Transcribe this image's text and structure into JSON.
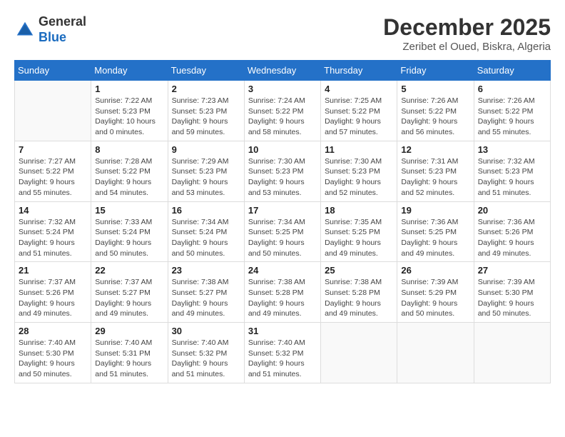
{
  "header": {
    "logo_general": "General",
    "logo_blue": "Blue",
    "month_title": "December 2025",
    "subtitle": "Zeribet el Oued, Biskra, Algeria"
  },
  "days_of_week": [
    "Sunday",
    "Monday",
    "Tuesday",
    "Wednesday",
    "Thursday",
    "Friday",
    "Saturday"
  ],
  "weeks": [
    [
      {
        "day": "",
        "info": ""
      },
      {
        "day": "1",
        "info": "Sunrise: 7:22 AM\nSunset: 5:23 PM\nDaylight: 10 hours\nand 0 minutes."
      },
      {
        "day": "2",
        "info": "Sunrise: 7:23 AM\nSunset: 5:23 PM\nDaylight: 9 hours\nand 59 minutes."
      },
      {
        "day": "3",
        "info": "Sunrise: 7:24 AM\nSunset: 5:22 PM\nDaylight: 9 hours\nand 58 minutes."
      },
      {
        "day": "4",
        "info": "Sunrise: 7:25 AM\nSunset: 5:22 PM\nDaylight: 9 hours\nand 57 minutes."
      },
      {
        "day": "5",
        "info": "Sunrise: 7:26 AM\nSunset: 5:22 PM\nDaylight: 9 hours\nand 56 minutes."
      },
      {
        "day": "6",
        "info": "Sunrise: 7:26 AM\nSunset: 5:22 PM\nDaylight: 9 hours\nand 55 minutes."
      }
    ],
    [
      {
        "day": "7",
        "info": "Sunrise: 7:27 AM\nSunset: 5:22 PM\nDaylight: 9 hours\nand 55 minutes."
      },
      {
        "day": "8",
        "info": "Sunrise: 7:28 AM\nSunset: 5:22 PM\nDaylight: 9 hours\nand 54 minutes."
      },
      {
        "day": "9",
        "info": "Sunrise: 7:29 AM\nSunset: 5:23 PM\nDaylight: 9 hours\nand 53 minutes."
      },
      {
        "day": "10",
        "info": "Sunrise: 7:30 AM\nSunset: 5:23 PM\nDaylight: 9 hours\nand 53 minutes."
      },
      {
        "day": "11",
        "info": "Sunrise: 7:30 AM\nSunset: 5:23 PM\nDaylight: 9 hours\nand 52 minutes."
      },
      {
        "day": "12",
        "info": "Sunrise: 7:31 AM\nSunset: 5:23 PM\nDaylight: 9 hours\nand 52 minutes."
      },
      {
        "day": "13",
        "info": "Sunrise: 7:32 AM\nSunset: 5:23 PM\nDaylight: 9 hours\nand 51 minutes."
      }
    ],
    [
      {
        "day": "14",
        "info": "Sunrise: 7:32 AM\nSunset: 5:24 PM\nDaylight: 9 hours\nand 51 minutes."
      },
      {
        "day": "15",
        "info": "Sunrise: 7:33 AM\nSunset: 5:24 PM\nDaylight: 9 hours\nand 50 minutes."
      },
      {
        "day": "16",
        "info": "Sunrise: 7:34 AM\nSunset: 5:24 PM\nDaylight: 9 hours\nand 50 minutes."
      },
      {
        "day": "17",
        "info": "Sunrise: 7:34 AM\nSunset: 5:25 PM\nDaylight: 9 hours\nand 50 minutes."
      },
      {
        "day": "18",
        "info": "Sunrise: 7:35 AM\nSunset: 5:25 PM\nDaylight: 9 hours\nand 49 minutes."
      },
      {
        "day": "19",
        "info": "Sunrise: 7:36 AM\nSunset: 5:25 PM\nDaylight: 9 hours\nand 49 minutes."
      },
      {
        "day": "20",
        "info": "Sunrise: 7:36 AM\nSunset: 5:26 PM\nDaylight: 9 hours\nand 49 minutes."
      }
    ],
    [
      {
        "day": "21",
        "info": "Sunrise: 7:37 AM\nSunset: 5:26 PM\nDaylight: 9 hours\nand 49 minutes."
      },
      {
        "day": "22",
        "info": "Sunrise: 7:37 AM\nSunset: 5:27 PM\nDaylight: 9 hours\nand 49 minutes."
      },
      {
        "day": "23",
        "info": "Sunrise: 7:38 AM\nSunset: 5:27 PM\nDaylight: 9 hours\nand 49 minutes."
      },
      {
        "day": "24",
        "info": "Sunrise: 7:38 AM\nSunset: 5:28 PM\nDaylight: 9 hours\nand 49 minutes."
      },
      {
        "day": "25",
        "info": "Sunrise: 7:38 AM\nSunset: 5:28 PM\nDaylight: 9 hours\nand 49 minutes."
      },
      {
        "day": "26",
        "info": "Sunrise: 7:39 AM\nSunset: 5:29 PM\nDaylight: 9 hours\nand 50 minutes."
      },
      {
        "day": "27",
        "info": "Sunrise: 7:39 AM\nSunset: 5:30 PM\nDaylight: 9 hours\nand 50 minutes."
      }
    ],
    [
      {
        "day": "28",
        "info": "Sunrise: 7:40 AM\nSunset: 5:30 PM\nDaylight: 9 hours\nand 50 minutes."
      },
      {
        "day": "29",
        "info": "Sunrise: 7:40 AM\nSunset: 5:31 PM\nDaylight: 9 hours\nand 51 minutes."
      },
      {
        "day": "30",
        "info": "Sunrise: 7:40 AM\nSunset: 5:32 PM\nDaylight: 9 hours\nand 51 minutes."
      },
      {
        "day": "31",
        "info": "Sunrise: 7:40 AM\nSunset: 5:32 PM\nDaylight: 9 hours\nand 51 minutes."
      },
      {
        "day": "",
        "info": ""
      },
      {
        "day": "",
        "info": ""
      },
      {
        "day": "",
        "info": ""
      }
    ]
  ]
}
